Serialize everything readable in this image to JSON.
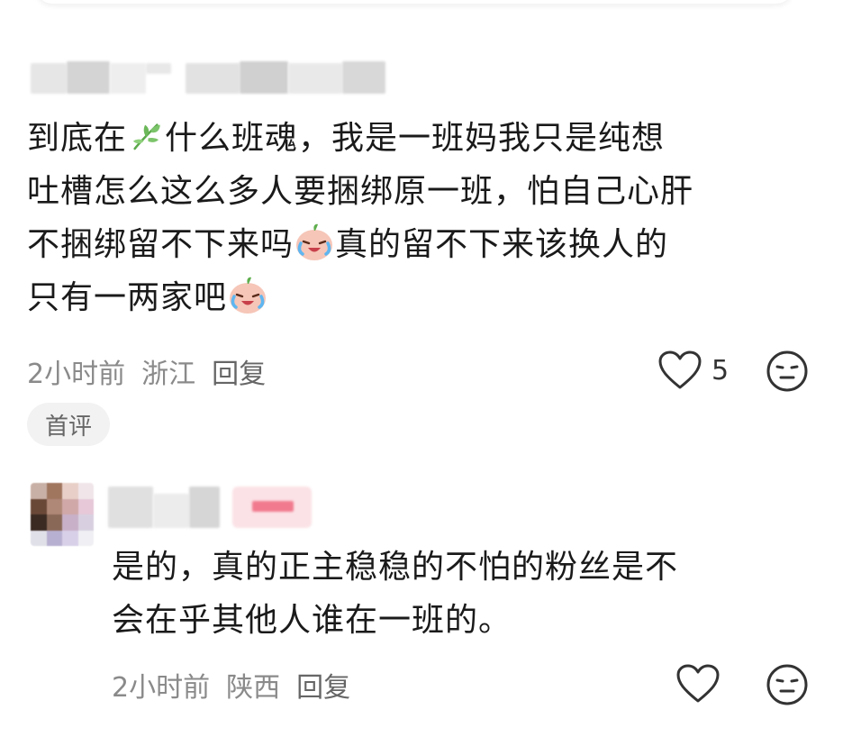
{
  "comment1": {
    "lines": [
      [
        "到底在",
        "什么班魂，我是一班妈我只是纯想"
      ],
      "吐槽怎么这么多人要捆绑原一班，怕自己心肝",
      [
        "不捆绑留不下来吗",
        "真的留不下来该换人的"
      ],
      [
        "只有一两家吧"
      ]
    ],
    "time": "2小时前",
    "location": "浙江",
    "reply_label": "回复",
    "like_count": "5",
    "badge": "首评"
  },
  "comment2": {
    "lines": [
      "是的，真的正主稳稳的不怕的粉丝是不",
      "会在乎其他人谁在一班的。"
    ],
    "time": "2小时前",
    "location": "陕西",
    "reply_label": "回复"
  },
  "icons": {
    "inline_1": "plant-sprout-icon",
    "inline_2": "crying-laugh-emoji-icon",
    "like": "heart-outline-icon",
    "react": "neutral-face-icon"
  },
  "colors": {
    "text": "#1a1a1a",
    "meta": "#8a8a8a",
    "badge_bg": "#f2f2f2",
    "icon": "#333333"
  }
}
